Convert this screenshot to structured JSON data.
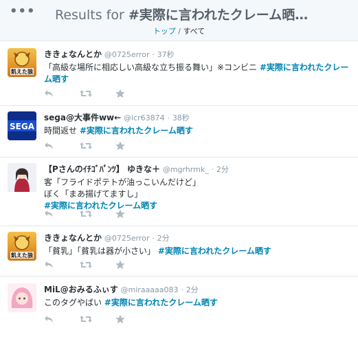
{
  "header": {
    "more_label": "•••",
    "title_prefix": "Results for ",
    "title_query": "#実際に言われたクレーム晒…",
    "crumb_top": "トップ",
    "crumb_sep": " / ",
    "crumb_current": "すべて"
  },
  "tweets": [
    {
      "name": "ききょなんとか",
      "handle": "@0725error",
      "dot": "·",
      "time": "37秒",
      "avatar_text": "飢えた狼",
      "text": "「高級な場所に相応しい高級な立ち振る舞い」※コンビニ ",
      "tag": "#実際に言われたクレーム晒す"
    },
    {
      "name": "sega@大事件ww←",
      "handle": "@icr63874",
      "dot": "·",
      "time": "38秒",
      "avatar_text": "SEGA",
      "text": "時間返せ ",
      "tag": "#実際に言われたクレーム晒す"
    },
    {
      "name": "【Pさんのｲﾁｺﾞﾊﾟﾝﾂ】 ゆきな＋",
      "handle": "@mgrhrmk_",
      "dot": "·",
      "time": "2分",
      "line1": "客「フライドポテトが油っこいんだけど」",
      "line2": "ぼく「まあ揚げてますし」",
      "tag": "#実際に言われたクレーム晒す"
    },
    {
      "name": "ききょなんとか",
      "handle": "@0725error",
      "dot": "·",
      "time": "2分",
      "avatar_text": "飢えた狼",
      "text": "「貧乳」「貧乳は器が小さい」 ",
      "tag": "#実際に言われたクレーム晒す"
    },
    {
      "name": "MiL@おみるふぃす",
      "handle": "@miraaaaa083",
      "dot": "·",
      "time": "2分",
      "text": "このタグやばい ",
      "tag": "#実際に言われたクレーム晒す"
    }
  ],
  "icons": {
    "reply": "reply-icon",
    "retweet": "retweet-icon",
    "favorite": "star-icon"
  },
  "colors": {
    "link": "#0084b4",
    "muted": "#8899a6",
    "action": "#b1bbc3"
  }
}
